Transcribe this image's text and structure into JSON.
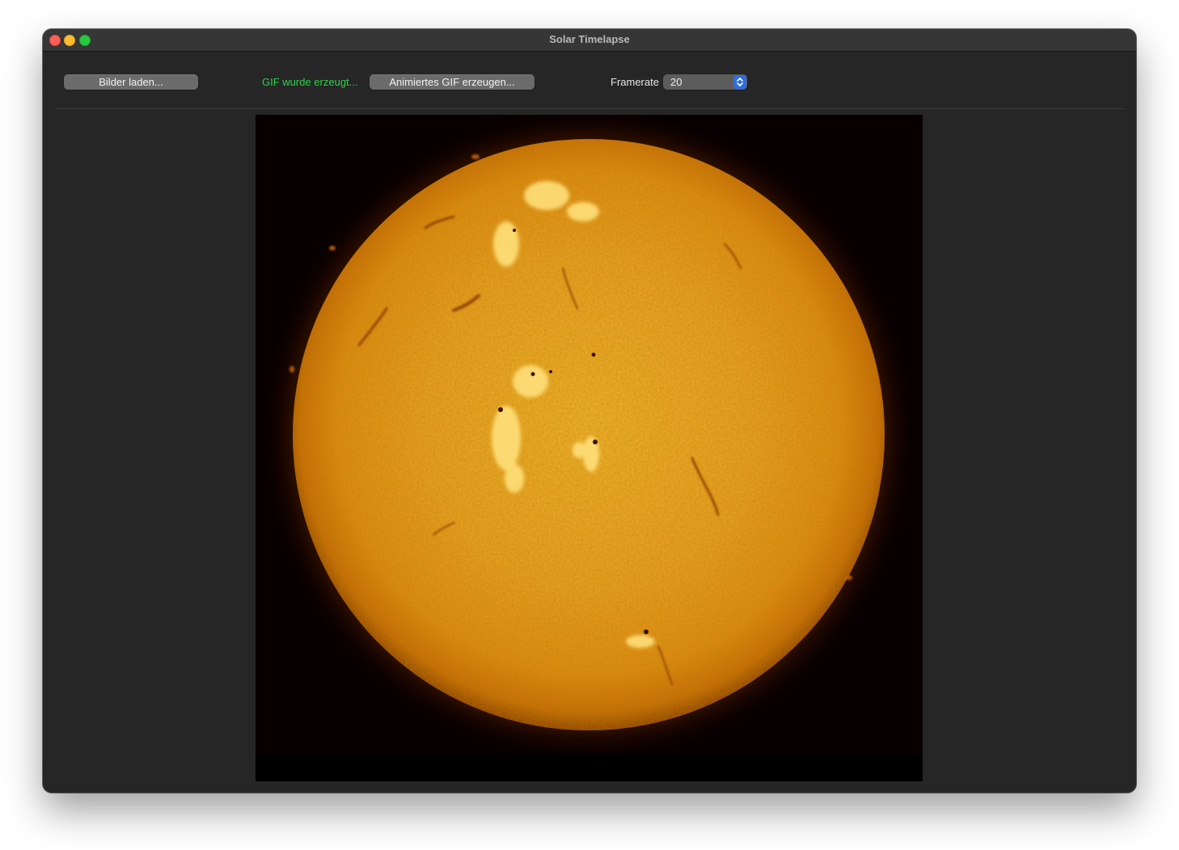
{
  "window": {
    "title": "Solar Timelapse"
  },
  "toolbar": {
    "load_images_label": "Bilder laden...",
    "status_text": "GIF wurde erzeugt...",
    "create_gif_label": "Animiertes GIF erzeugen...",
    "framerate_label": "Framerate",
    "framerate_value": "20"
  },
  "colors": {
    "status": "#2fd04a",
    "accent": "#2f6ee0",
    "window_bg": "#262626"
  },
  "icons": {
    "traffic_lights": [
      "close-icon",
      "minimize-icon",
      "zoom-icon"
    ],
    "stepper": "chevron-up-down-icon"
  }
}
